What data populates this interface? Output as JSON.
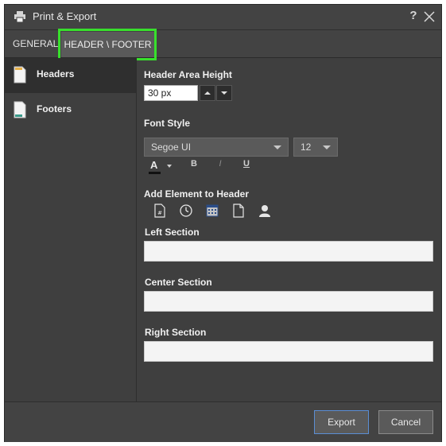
{
  "window": {
    "title": "Print & Export",
    "help_label": "?"
  },
  "tabs": {
    "general": "GENERAL",
    "header_footer": "HEADER \\ FOOTER"
  },
  "sidebar": {
    "headers": "Headers",
    "footers": "Footers"
  },
  "header_area": {
    "label": "Header Area Height",
    "value": "30 px"
  },
  "font_style": {
    "label": "Font Style",
    "font": "Segoe UI",
    "size": "12"
  },
  "format": {
    "font_color": "A",
    "bold": "B",
    "italic": "I",
    "underline": "U"
  },
  "add_element": {
    "label": "Add Element to Header",
    "icons": [
      "page-number-icon",
      "clock-icon",
      "calendar-icon",
      "page-icon",
      "user-icon"
    ]
  },
  "sections": {
    "left": "Left Section",
    "center": "Center Section",
    "right": "Right Section"
  },
  "footer": {
    "export": "Export",
    "cancel": "Cancel"
  },
  "colors": {
    "highlight": "#38e02c",
    "export_border": "#5b8ed4",
    "headers_accent": "#e8b24a",
    "footers_accent": "#3a9a8a"
  }
}
